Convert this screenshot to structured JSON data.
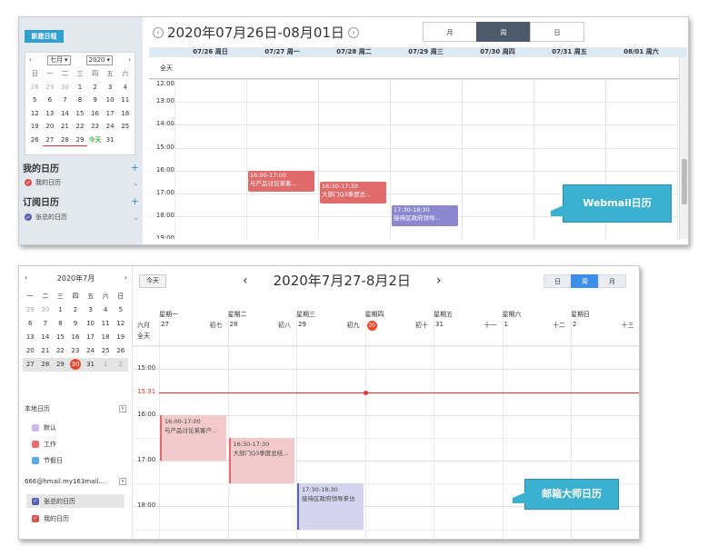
{
  "webmail": {
    "new_event_label": "新建日程",
    "mini_cal": {
      "prev": "‹",
      "next": "›",
      "month_value": "七月",
      "year_value": "2020",
      "weekdays": [
        "日",
        "一",
        "二",
        "三",
        "四",
        "五",
        "六"
      ],
      "weeks": [
        [
          "28",
          "29",
          "30",
          "1",
          "2",
          "3",
          "4"
        ],
        [
          "5",
          "6",
          "7",
          "8",
          "9",
          "10",
          "11"
        ],
        [
          "12",
          "13",
          "14",
          "15",
          "16",
          "17",
          "18"
        ],
        [
          "19",
          "20",
          "21",
          "22",
          "23",
          "24",
          "25"
        ],
        [
          "26",
          "27",
          "28",
          "29",
          "今天",
          "31",
          ""
        ]
      ]
    },
    "my_cal_title": "我的日历",
    "my_cal_add": "+",
    "my_cal_item": "我的日历",
    "sub_cal_title": "订阅日历",
    "sub_cal_add": "+",
    "sub_cal_item": "张总的日历",
    "title": "2020年07月26日-08月01日",
    "title_prev": "‹",
    "title_next": "›",
    "views": [
      "月",
      "周",
      "日"
    ],
    "active_view": "周",
    "day_headers": [
      "07/26 周日",
      "07/27 周一",
      "07/28 周二",
      "07/29 周三",
      "07/30 周四",
      "07/31 周五",
      "08/01 周六"
    ],
    "allday_label": "全天",
    "hours": [
      "12:00",
      "13:00",
      "14:00",
      "15:00",
      "16:00",
      "17:00",
      "18:00",
      "19:00"
    ],
    "events": [
      {
        "time": "16:00-17:00",
        "title": "与产品讨论某客…",
        "color": "#e06b6b"
      },
      {
        "time": "16:30-17:30",
        "title": "大部门Q3季度总…",
        "color": "#e06b6b"
      },
      {
        "time": "17:30-18:30",
        "title": "接待区政府领导…",
        "color": "#8b88cf"
      }
    ],
    "callout": "Webmail日历"
  },
  "mailmaster": {
    "mini_cal": {
      "prev": "‹",
      "next": "›",
      "month_title": "2020年7月",
      "weekdays": [
        "一",
        "二",
        "三",
        "四",
        "五",
        "六",
        "日"
      ],
      "weeks": [
        [
          "29",
          "30",
          "1",
          "2",
          "3",
          "4",
          "5"
        ],
        [
          "6",
          "7",
          "8",
          "9",
          "10",
          "11",
          "12"
        ],
        [
          "13",
          "14",
          "15",
          "16",
          "17",
          "18",
          "19"
        ],
        [
          "20",
          "21",
          "22",
          "23",
          "24",
          "25",
          "26"
        ],
        [
          "27",
          "28",
          "29",
          "30",
          "31",
          "1",
          "2"
        ]
      ]
    },
    "local_cal_title": "本地日历",
    "local_cals": [
      {
        "name": "默认",
        "color": "#c9b8ec"
      },
      {
        "name": "工作",
        "color": "#ec6f6f"
      },
      {
        "name": "节假日",
        "color": "#5aa6ea"
      }
    ],
    "account": "666@hmail.my163mail....",
    "account_cals": [
      {
        "name": "张总的日历",
        "color": "#5a5fb0",
        "checked": true
      },
      {
        "name": "我的日历",
        "color": "#d9534f",
        "checked": true
      }
    ],
    "today_button": "今天",
    "title": "2020年7月27-8月2日",
    "title_prev": "‹",
    "title_next": "›",
    "views": [
      "日",
      "周",
      "月"
    ],
    "active_view": "周",
    "weekday_headers": [
      "星期一",
      "星期二",
      "星期三",
      "星期四",
      "星期五",
      "星期六",
      "星期日"
    ],
    "month_prefix": "六月",
    "allday_label": "全天",
    "dates": [
      {
        "day": "27",
        "lunar": "初七"
      },
      {
        "day": "28",
        "lunar": "初八"
      },
      {
        "day": "29",
        "lunar": "初九"
      },
      {
        "day": "30",
        "lunar": "初十"
      },
      {
        "day": "31",
        "lunar": "十一"
      },
      {
        "day": "1",
        "lunar": "十二"
      },
      {
        "day": "2",
        "lunar": "十三"
      }
    ],
    "hours": [
      "15:00",
      "16:00",
      "17:00",
      "18:00"
    ],
    "now_time": "15:31",
    "events": [
      {
        "time": "16:00-17:00",
        "title": "与产品讨论某客户...",
        "bg": "#f2caca",
        "border": "#e06b6b"
      },
      {
        "time": "16:30-17:30",
        "title": "大部门Q3季度总结...",
        "bg": "#f2caca",
        "border": "#e06b6b"
      },
      {
        "time": "17:30-18:30",
        "title": "接待区政府领导来访",
        "bg": "#d4d4ee",
        "border": "#5a5fb0"
      }
    ],
    "callout": "邮箱大师日历"
  }
}
